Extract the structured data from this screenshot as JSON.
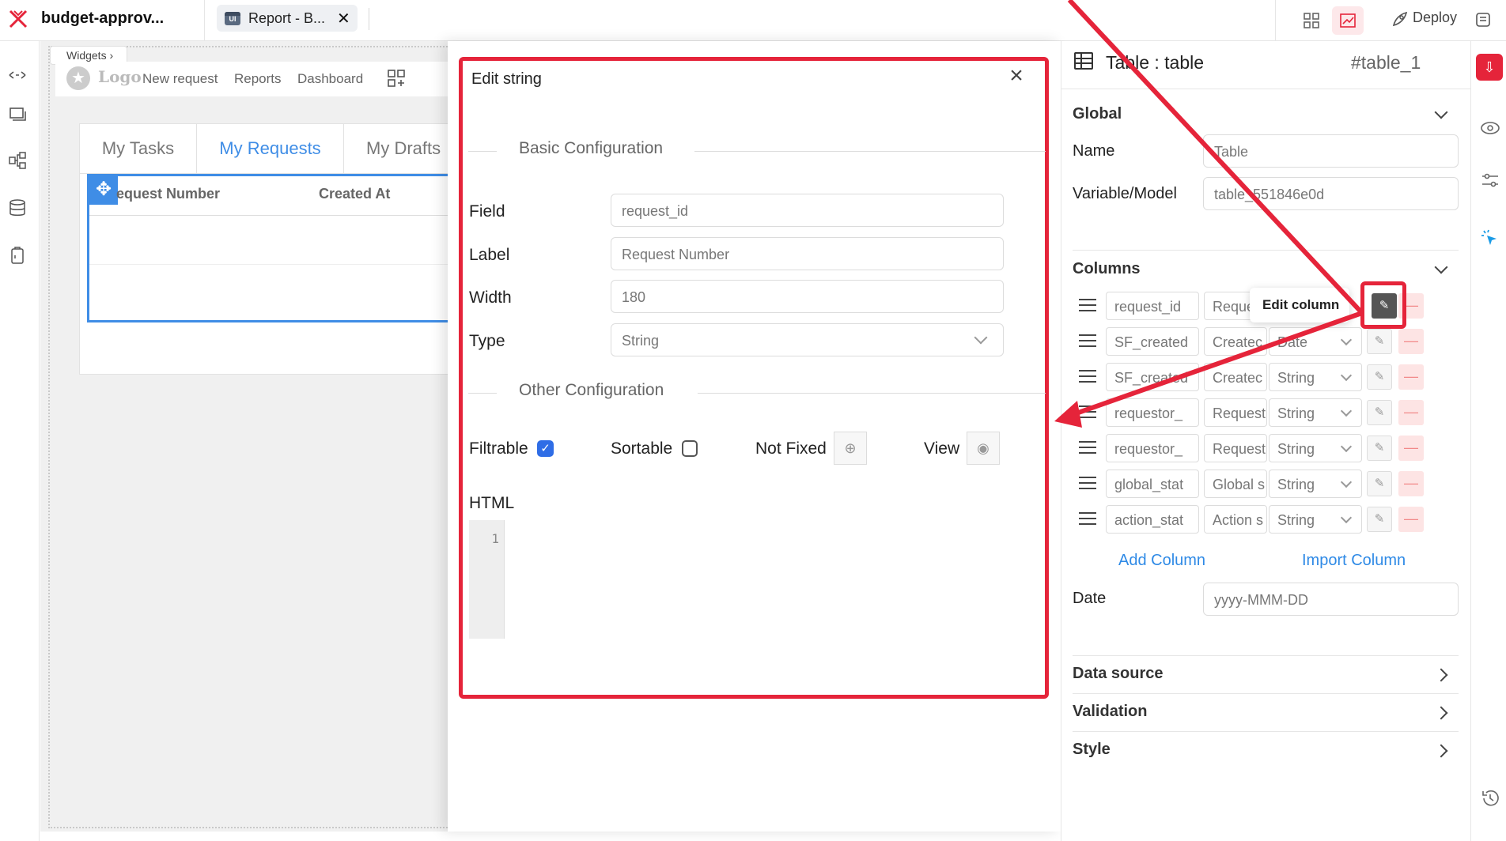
{
  "topbar": {
    "app_title": "budget-approv...",
    "page_tab_label": "Report - B...",
    "page_tab_badge": "UI",
    "deploy_label": "Deploy"
  },
  "canvas": {
    "widgets_crumb": "Widgets ›",
    "logo_text": "Logo",
    "nav": [
      "New request",
      "Reports",
      "Dashboard"
    ],
    "tabs": [
      "My Tasks",
      "My Requests",
      "My Drafts"
    ],
    "active_tab": "My Requests",
    "table_headers": [
      "equest Number",
      "Created At"
    ]
  },
  "dialog": {
    "title": "Edit string",
    "basic_section": "Basic Configuration",
    "other_section": "Other Configuration",
    "fields": {
      "field_label": "Field",
      "field_value": "request_id",
      "label_label": "Label",
      "label_value": "Request Number",
      "width_label": "Width",
      "width_value": "180",
      "type_label": "Type",
      "type_value": "String"
    },
    "options": {
      "filtrable_label": "Filtrable",
      "filtrable_checked": true,
      "sortable_label": "Sortable",
      "sortable_checked": false,
      "fixed_label": "Not Fixed",
      "view_label": "View"
    },
    "html_label": "HTML",
    "code_line": "1"
  },
  "panel": {
    "title": "Table : table",
    "id": "#table_1",
    "global_header": "Global",
    "name_label": "Name",
    "name_value": "Table",
    "model_label": "Variable/Model",
    "model_value": "table_551846e0d",
    "columns_header": "Columns",
    "columns": [
      {
        "field": "request_id",
        "label": "Reque",
        "type": ""
      },
      {
        "field": "SF_created",
        "label": "Createc",
        "type": "Date"
      },
      {
        "field": "SF_created",
        "label": "Createc",
        "type": "String"
      },
      {
        "field": "requestor_",
        "label": "Request",
        "type": "String"
      },
      {
        "field": "requestor_",
        "label": "Request",
        "type": "String"
      },
      {
        "field": "global_stat",
        "label": "Global s",
        "type": "String"
      },
      {
        "field": "action_stat",
        "label": "Action s",
        "type": "String"
      }
    ],
    "tooltip": "Edit column",
    "add_column": "Add Column",
    "import_column": "Import Column",
    "date_label": "Date",
    "date_placeholder": "yyyy-MMM-DD",
    "data_source": "Data source",
    "validation": "Validation",
    "style": "Style"
  },
  "colors": {
    "annotation_red": "#e5243a",
    "accent_blue": "#2f8ae6",
    "checkbox_blue": "#2f6de6"
  }
}
